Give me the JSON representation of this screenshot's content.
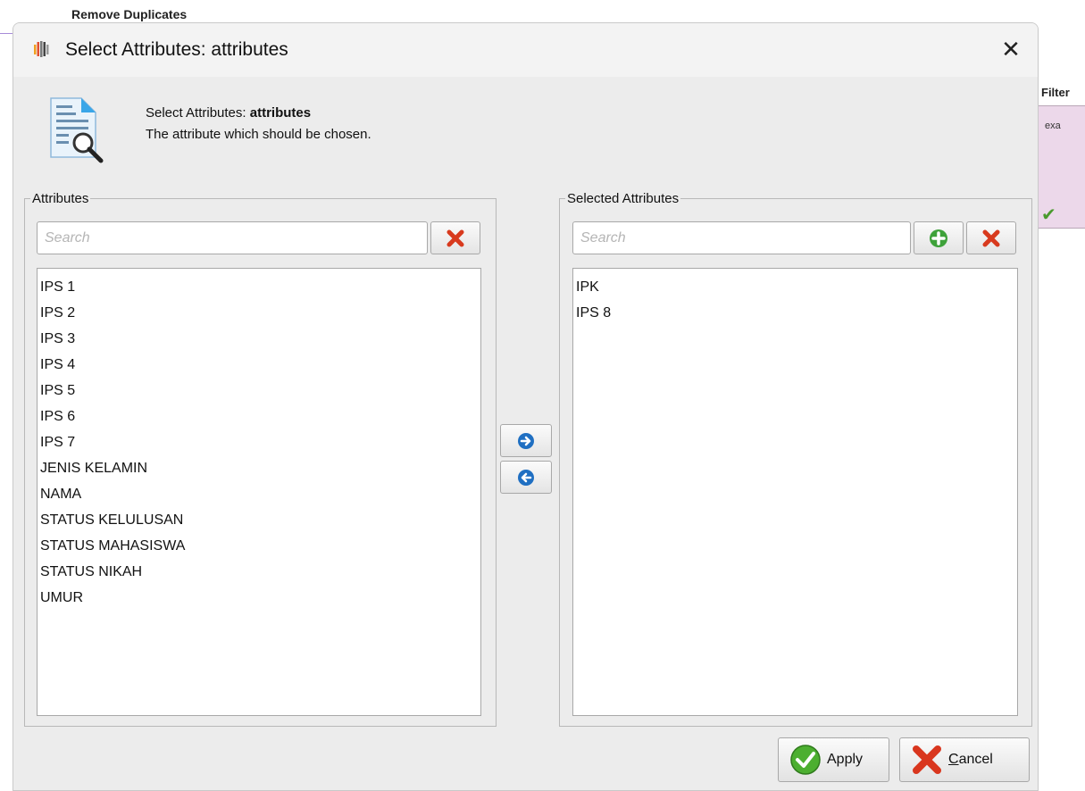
{
  "background": {
    "operator_label": "Remove Duplicates",
    "filter_title": "Filter",
    "filter_text": "exa"
  },
  "dialog": {
    "title": "Select Attributes: attributes",
    "header_prefix": "Select Attributes: ",
    "header_param": "attributes",
    "description": "The attribute which should be chosen."
  },
  "attributes_panel": {
    "legend": "Attributes",
    "search_placeholder": "Search",
    "items": [
      "IPS 1",
      "IPS 2",
      "IPS 3",
      "IPS 4",
      "IPS 5",
      "IPS 6",
      "IPS 7",
      "JENIS KELAMIN",
      "NAMA",
      "STATUS KELULUSAN",
      "STATUS MAHASISWA",
      "STATUS NIKAH",
      "UMUR"
    ]
  },
  "selected_panel": {
    "legend": "Selected Attributes",
    "search_placeholder": "Search",
    "items": [
      "IPK",
      "IPS 8"
    ]
  },
  "buttons": {
    "apply": "Apply",
    "cancel": "Cancel"
  },
  "colors": {
    "accent_blue": "#1f6fc2",
    "clear_red": "#d83a1e",
    "add_green": "#3ea23a",
    "apply_green": "#4caf30",
    "cancel_red": "#d9361e"
  }
}
